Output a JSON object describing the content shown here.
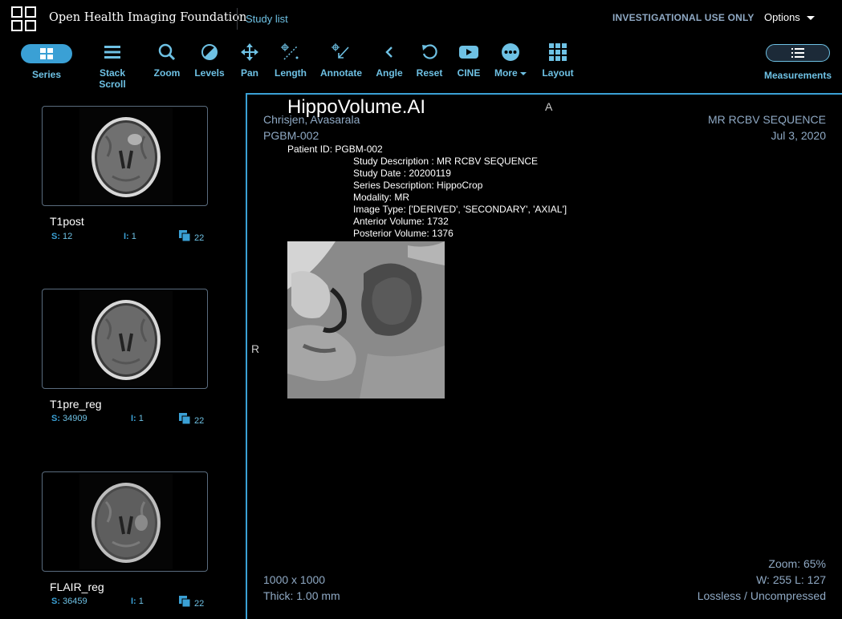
{
  "header": {
    "brand": "Open Health Imaging Foundation",
    "study_list": "Study list",
    "notice": "INVESTIGATIONAL USE ONLY",
    "options": "Options"
  },
  "toolbar": {
    "series": "Series",
    "stack_scroll": "Stack Scroll",
    "zoom": "Zoom",
    "levels": "Levels",
    "pan": "Pan",
    "length": "Length",
    "annotate": "Annotate",
    "angle": "Angle",
    "reset": "Reset",
    "cine": "CINE",
    "more": "More",
    "layout": "Layout",
    "measurements": "Measurements"
  },
  "series_list": [
    {
      "title": "T1post",
      "s_label": "S:",
      "s_value": "12",
      "i_label": "I:",
      "i_value": "1",
      "count": "22"
    },
    {
      "title": "T1pre_reg",
      "s_label": "S:",
      "s_value": "34909",
      "i_label": "I:",
      "i_value": "1",
      "count": "22"
    },
    {
      "title": "FLAIR_reg",
      "s_label": "S:",
      "s_value": "36459",
      "i_label": "I:",
      "i_value": "1",
      "count": "22"
    }
  ],
  "viewport": {
    "app_title": "HippoVolume.AI",
    "orientation_top": "A",
    "orientation_left": "R",
    "patient_name": "Chrisjen, Avasarala",
    "patient_mrn": "PGBM-002",
    "series_name": "MR RCBV SEQUENCE",
    "study_date_display": "Jul 3, 2020",
    "report": {
      "patient_id": "Patient ID: PGBM-002",
      "study_description": "Study Description : MR RCBV SEQUENCE",
      "study_date": "Study Date : 20200119",
      "series_description": "Series Description: HippoCrop",
      "modality": "Modality: MR",
      "image_type": "Image Type: ['DERIVED', 'SECONDARY', 'AXIAL']",
      "anterior_volume": "Anterior Volume: 1732",
      "posterior_volume": "Posterior Volume: 1376"
    },
    "dimensions": "1000 x 1000",
    "thickness": "Thick: 1.00 mm",
    "zoom": "Zoom: 65%",
    "window_level": "W: 255 L: 127",
    "compression": "Lossless / Uncompressed"
  },
  "colors": {
    "accent": "#3aa0d5",
    "accent_text": "#6ec1e4",
    "overlay_text": "#8fa9c4",
    "background": "#000000"
  }
}
